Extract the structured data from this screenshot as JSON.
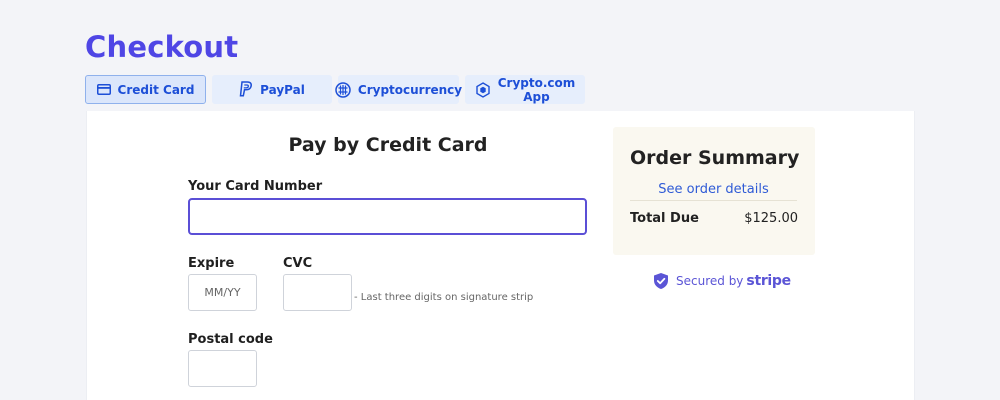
{
  "page": {
    "title": "Checkout"
  },
  "tabs": [
    {
      "label": "Credit Card",
      "icon": "credit-card-icon",
      "active": true
    },
    {
      "label": "PayPal",
      "icon": "paypal-icon",
      "active": false
    },
    {
      "label": "Cryptocurrency",
      "icon": "crypto-globe-icon",
      "active": false
    },
    {
      "label_line1": "Crypto.com",
      "label_line2": "App",
      "icon": "crypto-com-icon",
      "active": false
    }
  ],
  "form": {
    "title": "Pay by Credit Card",
    "card_number_label": "Your Card Number",
    "card_number_value": "",
    "expire_label": "Expire",
    "expire_placeholder": "MM/YY",
    "cvc_label": "CVC",
    "cvc_value": "",
    "cvc_hint": "- Last three digits on signature strip",
    "postal_label": "Postal code",
    "postal_value": ""
  },
  "summary": {
    "title": "Order Summary",
    "details_link": "See order details",
    "total_label": "Total Due",
    "total_value": "$125.00"
  },
  "security": {
    "secured_by": "Secured by",
    "provider": "stripe"
  },
  "colors": {
    "accent": "#4f46e5",
    "tab_text": "#1d4fd7",
    "tab_bg": "#e6eefc",
    "focus_border": "#5b4fd6",
    "summary_bg": "#faf8f0",
    "link": "#2f5bd6"
  }
}
